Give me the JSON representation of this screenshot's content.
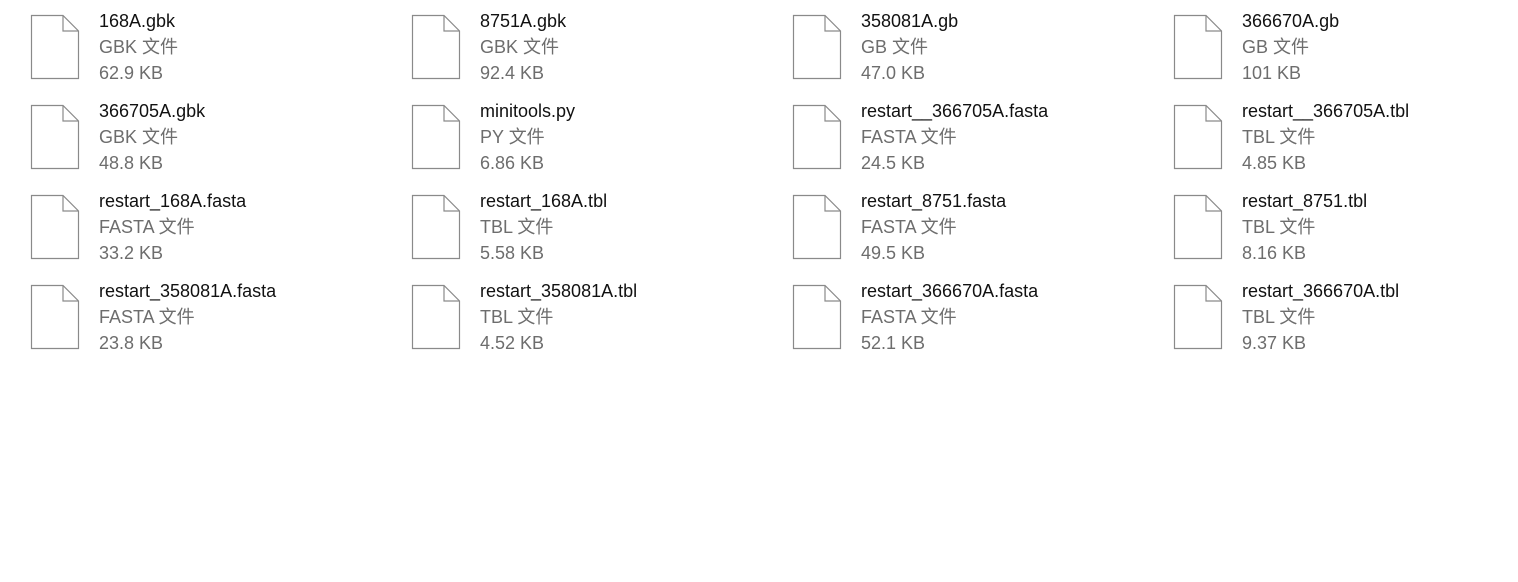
{
  "files": [
    {
      "name": "168A.gbk",
      "type": "GBK 文件",
      "size": "62.9 KB",
      "icon": "generic-file-icon"
    },
    {
      "name": "8751A.gbk",
      "type": "GBK 文件",
      "size": "92.4 KB",
      "icon": "generic-file-icon"
    },
    {
      "name": "358081A.gb",
      "type": "GB 文件",
      "size": "47.0 KB",
      "icon": "generic-file-icon"
    },
    {
      "name": "366670A.gb",
      "type": "GB 文件",
      "size": "101 KB",
      "icon": "generic-file-icon"
    },
    {
      "name": "366705A.gbk",
      "type": "GBK 文件",
      "size": "48.8 KB",
      "icon": "generic-file-icon"
    },
    {
      "name": "minitools.py",
      "type": "PY 文件",
      "size": "6.86 KB",
      "icon": "generic-file-icon"
    },
    {
      "name": "restart__366705A.fasta",
      "type": "FASTA 文件",
      "size": "24.5 KB",
      "icon": "generic-file-icon"
    },
    {
      "name": "restart__366705A.tbl",
      "type": "TBL 文件",
      "size": "4.85 KB",
      "icon": "generic-file-icon"
    },
    {
      "name": "restart_168A.fasta",
      "type": "FASTA 文件",
      "size": "33.2 KB",
      "icon": "generic-file-icon"
    },
    {
      "name": "restart_168A.tbl",
      "type": "TBL 文件",
      "size": "5.58 KB",
      "icon": "generic-file-icon"
    },
    {
      "name": "restart_8751.fasta",
      "type": "FASTA 文件",
      "size": "49.5 KB",
      "icon": "generic-file-icon"
    },
    {
      "name": "restart_8751.tbl",
      "type": "TBL 文件",
      "size": "8.16 KB",
      "icon": "generic-file-icon"
    },
    {
      "name": "restart_358081A.fasta",
      "type": "FASTA 文件",
      "size": "23.8 KB",
      "icon": "generic-file-icon"
    },
    {
      "name": "restart_358081A.tbl",
      "type": "TBL 文件",
      "size": "4.52 KB",
      "icon": "generic-file-icon"
    },
    {
      "name": "restart_366670A.fasta",
      "type": "FASTA 文件",
      "size": "52.1 KB",
      "icon": "generic-file-icon"
    },
    {
      "name": "restart_366670A.tbl",
      "type": "TBL 文件",
      "size": "9.37 KB",
      "icon": "generic-file-icon"
    }
  ],
  "colors": {
    "background": "#ffffff",
    "name_text": "#111111",
    "meta_text": "#6d6d6d",
    "icon_outline": "#8a8a8a",
    "icon_fill": "#ffffff"
  }
}
